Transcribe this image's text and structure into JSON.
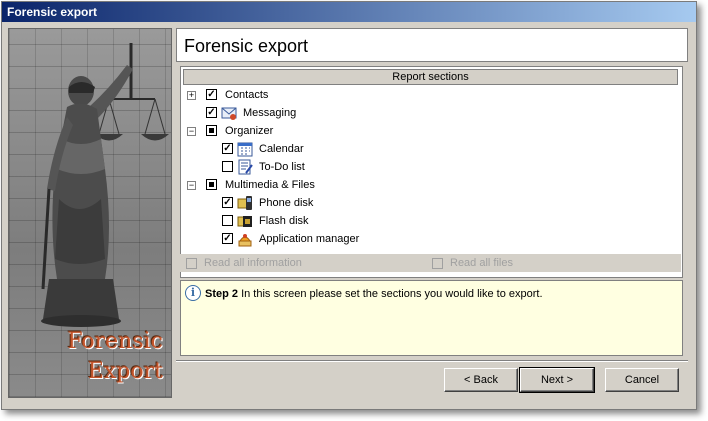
{
  "window": {
    "title": "Forensic export"
  },
  "sidebar": {
    "brand_line1": "Forensic",
    "brand_line2": "Export"
  },
  "header": {
    "title": "Forensic export"
  },
  "sections": {
    "header": "Report sections",
    "items": [
      {
        "label": "Contacts",
        "checked": "full",
        "expander": "+",
        "icon": ""
      },
      {
        "label": "Messaging",
        "checked": "full",
        "icon": "messaging-icon"
      },
      {
        "label": "Organizer",
        "checked": "partial",
        "expander": "-",
        "icon": ""
      },
      {
        "label": "Calendar",
        "checked": "full",
        "icon": "calendar-icon"
      },
      {
        "label": "To-Do list",
        "checked": "none",
        "icon": "todo-icon"
      },
      {
        "label": "Multimedia & Files",
        "checked": "partial",
        "expander": "-",
        "icon": ""
      },
      {
        "label": "Phone disk",
        "checked": "full",
        "icon": "phone-disk-icon"
      },
      {
        "label": "Flash disk",
        "checked": "none",
        "icon": "flash-disk-icon"
      },
      {
        "label": "Application manager",
        "checked": "full",
        "icon": "application-manager-icon"
      }
    ]
  },
  "options": {
    "read_all_info": "Read all information",
    "read_all_files": "Read all files"
  },
  "info": {
    "step": "Step 2",
    "text": " In this screen please set the sections you would like to export."
  },
  "buttons": {
    "back": "< Back",
    "next": "Next >",
    "cancel": "Cancel"
  }
}
